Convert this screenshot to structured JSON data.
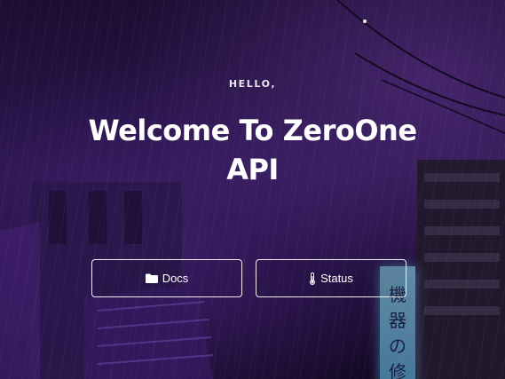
{
  "hero": {
    "greeting": "HELLO,",
    "title_line1": "Welcome To ZeroOne",
    "title_line2": "API"
  },
  "buttons": {
    "docs_label": "Docs",
    "docs_icon": "folder-icon",
    "status_label": "Status",
    "status_icon": "thermometer-icon"
  },
  "background": {
    "sign_text": "機器の修"
  },
  "colors": {
    "accent_purple": "#3a1f66",
    "text_white": "#ffffff",
    "sign_blue": "#8fd3f0"
  }
}
